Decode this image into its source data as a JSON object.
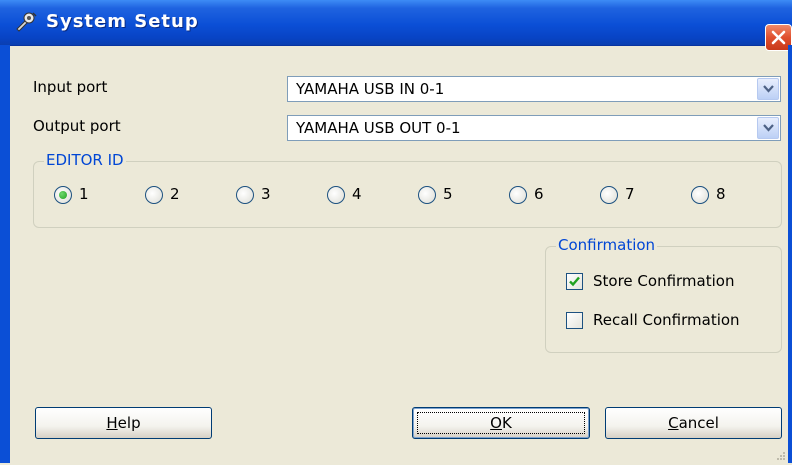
{
  "window": {
    "title": "System Setup",
    "app_icon": "settings-tool-icon",
    "close_icon": "close-icon"
  },
  "ports": {
    "input_label": "Input port",
    "input_value": "YAMAHA USB IN 0-1",
    "output_label": "Output port",
    "output_value": "YAMAHA USB OUT 0-1"
  },
  "editor_id": {
    "legend": "EDITOR ID",
    "options": [
      "1",
      "2",
      "3",
      "4",
      "5",
      "6",
      "7",
      "8"
    ],
    "selected": "1"
  },
  "confirmation": {
    "legend": "Confirmation",
    "store_label": "Store Confirmation",
    "store_checked": true,
    "recall_label": "Recall Confirmation",
    "recall_checked": false
  },
  "buttons": {
    "help_mnemonic": "H",
    "help_rest": "elp",
    "ok_mnemonic": "O",
    "ok_rest": "K",
    "cancel_mnemonic": "C",
    "cancel_rest": "ancel"
  },
  "colors": {
    "title_bar": "#0b4fd6",
    "group_legend": "#0046d5",
    "dialog_bg": "#ece9d8",
    "close": "#e0502e"
  }
}
